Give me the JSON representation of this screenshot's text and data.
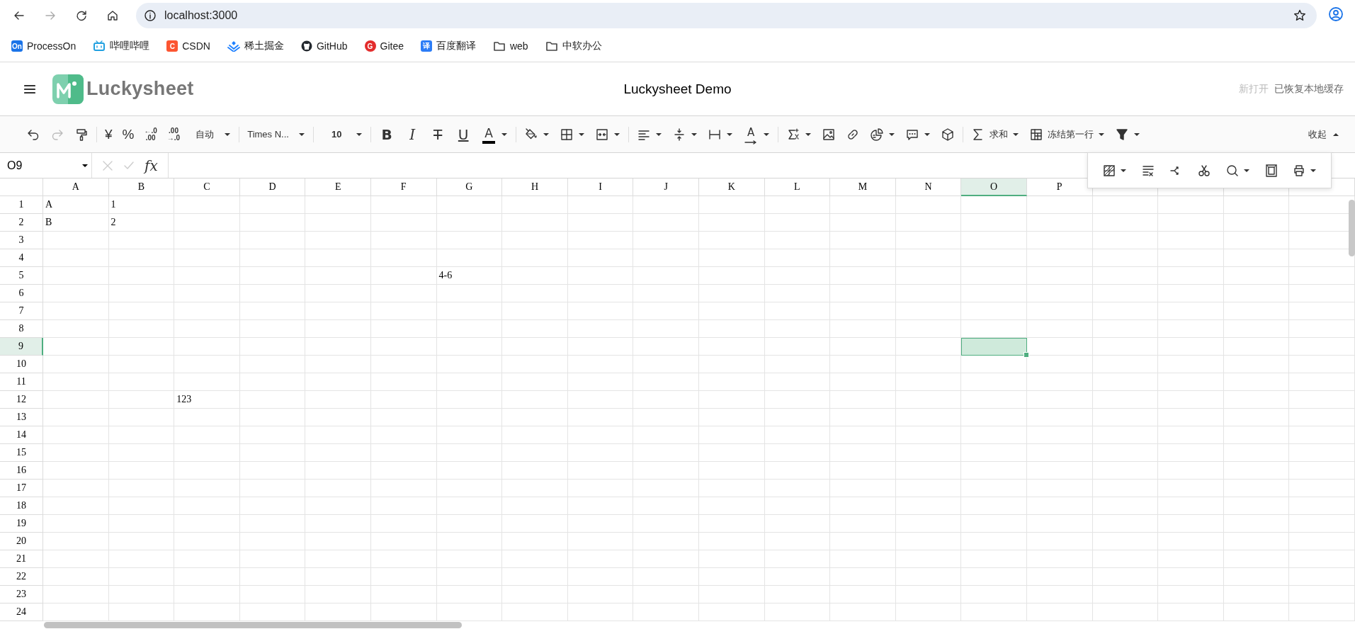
{
  "browser": {
    "url": "localhost:3000",
    "nav_buttons": [
      {
        "disabled": false
      },
      {
        "disabled": true
      },
      {
        "disabled": false
      },
      {
        "disabled": false
      }
    ],
    "bookmarks": [
      {
        "label": "ProcessOn",
        "kind": "badge",
        "badge": "On",
        "color": "#1a73e8"
      },
      {
        "label": "哔哩哔哩",
        "kind": "tv",
        "color": "#20a0e0"
      },
      {
        "label": "CSDN",
        "kind": "badge",
        "badge": "C",
        "color": "#fc5531"
      },
      {
        "label": "稀土掘金",
        "kind": "chevrons",
        "color": "#1e80ff"
      },
      {
        "label": "GitHub",
        "kind": "octocat",
        "color": "#24292f"
      },
      {
        "label": "Gitee",
        "kind": "round",
        "badge": "G",
        "color": "#e32c2c"
      },
      {
        "label": "百度翻译",
        "kind": "badge",
        "badge": "译",
        "color": "#2b7cf6"
      },
      {
        "label": "web",
        "kind": "folder"
      },
      {
        "label": "中软办公",
        "kind": "folder"
      }
    ]
  },
  "header": {
    "logo_text": "Luckysheet",
    "title": "Luckysheet Demo",
    "status": [
      {
        "text": "新打开",
        "muted": true
      },
      {
        "text": "已恢复本地缓存",
        "muted": false
      }
    ]
  },
  "toolbar": {
    "items": [
      {
        "kind": "icon",
        "dropdown": false,
        "disabled": false
      },
      {
        "kind": "icon",
        "dropdown": false,
        "disabled": true
      },
      {
        "kind": "icon",
        "dropdown": false,
        "disabled": false
      },
      {
        "kind": "separator"
      },
      {
        "kind": "text",
        "label": "¥",
        "dropdown": false,
        "disabled": false
      },
      {
        "kind": "text",
        "label": "%",
        "dropdown": false,
        "disabled": false
      },
      {
        "kind": "stack",
        "top": "←.0",
        "bottom": ".00",
        "dropdown": false,
        "disabled": false
      },
      {
        "kind": "stack",
        "top": ".00",
        "bottom": "→.0",
        "dropdown": false,
        "disabled": false
      },
      {
        "kind": "text",
        "label": "自动",
        "dropdown": true,
        "disabled": false
      },
      {
        "kind": "separator"
      },
      {
        "kind": "text",
        "label": "Times N...",
        "dropdown": true,
        "disabled": false
      },
      {
        "kind": "separator"
      },
      {
        "kind": "text",
        "label": "10",
        "dropdown": true,
        "disabled": false
      },
      {
        "kind": "separator"
      },
      {
        "kind": "letter",
        "label": "B",
        "dropdown": false,
        "disabled": false
      },
      {
        "kind": "letter",
        "label": "I",
        "dropdown": false,
        "disabled": false
      },
      {
        "kind": "letter",
        "label": "T",
        "dropdown": false,
        "disabled": false
      },
      {
        "kind": "letter",
        "label": "U",
        "dropdown": false,
        "disabled": false
      },
      {
        "kind": "letter",
        "label": "A",
        "dropdown": true,
        "disabled": false
      },
      {
        "kind": "separator"
      },
      {
        "kind": "icon",
        "dropdown": true,
        "disabled": false
      },
      {
        "kind": "icon",
        "dropdown": true,
        "disabled": false
      },
      {
        "kind": "icon",
        "dropdown": true,
        "disabled": false
      },
      {
        "kind": "separator"
      },
      {
        "kind": "icon",
        "dropdown": true,
        "disabled": false
      },
      {
        "kind": "icon",
        "dropdown": true,
        "disabled": false
      },
      {
        "kind": "icon",
        "dropdown": true,
        "disabled": false
      },
      {
        "kind": "letter",
        "label": "A",
        "dropdown": true,
        "disabled": false
      },
      {
        "kind": "separator"
      },
      {
        "kind": "icon",
        "dropdown": true,
        "disabled": false
      },
      {
        "kind": "icon",
        "dropdown": false,
        "disabled": false
      },
      {
        "kind": "icon",
        "dropdown": false,
        "disabled": false
      },
      {
        "kind": "icon",
        "dropdown": true,
        "disabled": false
      },
      {
        "kind": "icon",
        "dropdown": true,
        "disabled": false
      },
      {
        "kind": "icon",
        "dropdown": false,
        "disabled": false
      },
      {
        "kind": "separator"
      },
      {
        "kind": "icon_text",
        "label": "求和",
        "dropdown": true,
        "disabled": false
      },
      {
        "kind": "icon_text",
        "label": "冻结第一行",
        "dropdown": true,
        "disabled": false
      },
      {
        "kind": "icon",
        "dropdown": true,
        "disabled": false
      }
    ],
    "collapse": "收起"
  },
  "formula_bar": {
    "cell_ref": "O9",
    "fx": "fx"
  },
  "float_toolbar": [
    {
      "dropdown": true
    },
    {
      "dropdown": false
    },
    {
      "dropdown": false
    },
    {
      "dropdown": false
    },
    {
      "dropdown": true
    },
    {
      "dropdown": false
    },
    {
      "dropdown": true
    }
  ],
  "sheet": {
    "columns": [
      {
        "label": "A",
        "selected": false
      },
      {
        "label": "B",
        "selected": false
      },
      {
        "label": "C",
        "selected": false
      },
      {
        "label": "D",
        "selected": false
      },
      {
        "label": "E",
        "selected": false
      },
      {
        "label": "F",
        "selected": false
      },
      {
        "label": "G",
        "selected": false
      },
      {
        "label": "H",
        "selected": false
      },
      {
        "label": "I",
        "selected": false
      },
      {
        "label": "J",
        "selected": false
      },
      {
        "label": "K",
        "selected": false
      },
      {
        "label": "L",
        "selected": false
      },
      {
        "label": "M",
        "selected": false
      },
      {
        "label": "N",
        "selected": false
      },
      {
        "label": "O",
        "selected": true
      },
      {
        "label": "P",
        "selected": false
      }
    ],
    "rows": [
      {
        "label": "1",
        "selected": false,
        "cells": [
          "A",
          "1"
        ]
      },
      {
        "label": "2",
        "selected": false,
        "cells": [
          "B",
          "2"
        ]
      },
      {
        "label": "3",
        "selected": false
      },
      {
        "label": "4",
        "selected": false
      },
      {
        "label": "5",
        "selected": false,
        "cells": [
          null,
          null,
          null,
          null,
          null,
          null,
          "4-6"
        ]
      },
      {
        "label": "6",
        "selected": false
      },
      {
        "label": "7",
        "selected": false
      },
      {
        "label": "8",
        "selected": false
      },
      {
        "label": "9",
        "selected": true
      },
      {
        "label": "10",
        "selected": false
      },
      {
        "label": "11",
        "selected": false
      },
      {
        "label": "12",
        "selected": false,
        "cells": [
          null,
          null,
          "123"
        ]
      },
      {
        "label": "13",
        "selected": false
      },
      {
        "label": "14",
        "selected": false
      },
      {
        "label": "15",
        "selected": false
      },
      {
        "label": "16",
        "selected": false
      },
      {
        "label": "17",
        "selected": false
      },
      {
        "label": "18",
        "selected": false
      },
      {
        "label": "19",
        "selected": false
      },
      {
        "label": "20",
        "selected": false
      },
      {
        "label": "21",
        "selected": false
      },
      {
        "label": "22",
        "selected": false
      },
      {
        "label": "23",
        "selected": false
      },
      {
        "label": "24",
        "selected": false
      }
    ]
  }
}
